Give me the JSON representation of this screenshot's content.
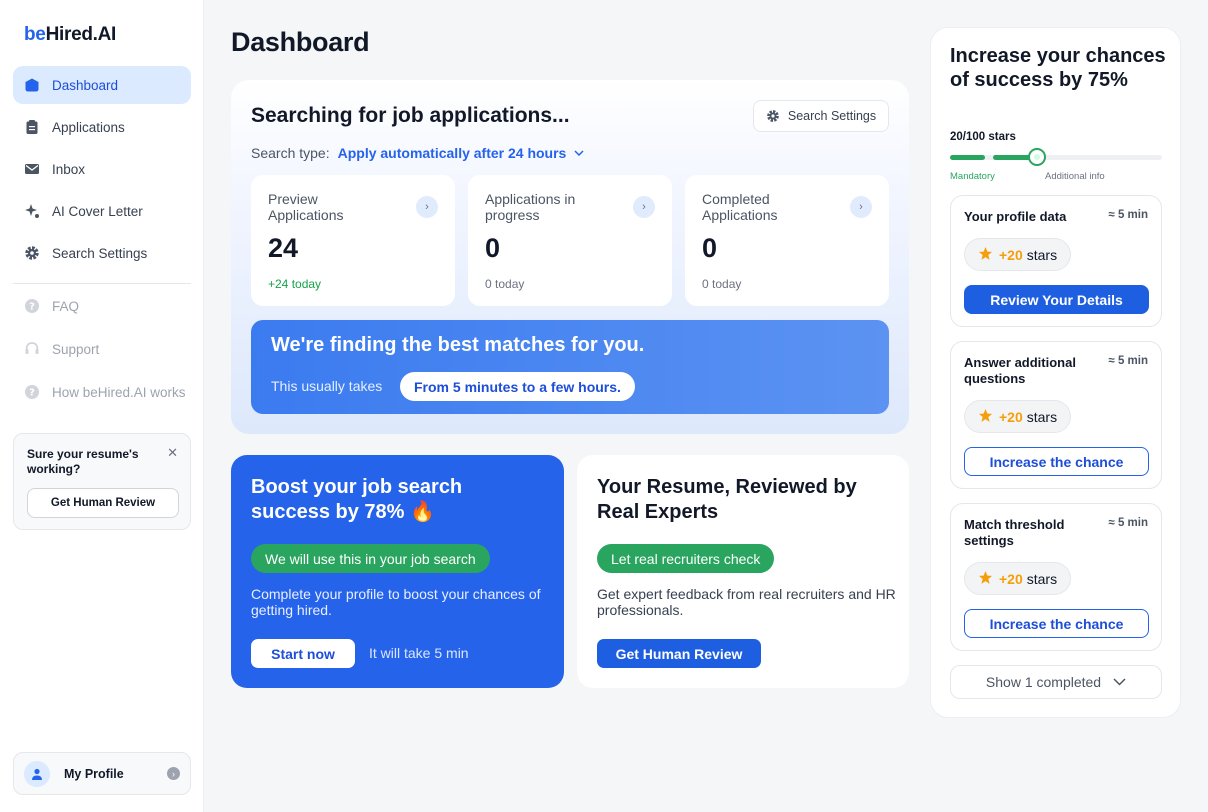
{
  "app": {
    "logo_prefix": "be",
    "logo_rest": "Hired.AI"
  },
  "sidebar": {
    "items": [
      {
        "label": "Dashboard",
        "icon": "dashboard-icon",
        "active": true
      },
      {
        "label": "Applications",
        "icon": "clipboard-icon"
      },
      {
        "label": "Inbox",
        "icon": "mail-icon"
      },
      {
        "label": "AI Cover Letter",
        "icon": "sparkle-icon"
      },
      {
        "label": "Search Settings",
        "icon": "gear-icon"
      }
    ],
    "secondary": [
      {
        "label": "FAQ",
        "icon": "help-icon"
      },
      {
        "label": "Support",
        "icon": "headset-icon"
      },
      {
        "label": "How beHired.AI works",
        "icon": "help-icon"
      }
    ],
    "promo": {
      "title": "Sure your resume's working?",
      "button": "Get Human Review"
    },
    "profile": {
      "label": "My Profile"
    }
  },
  "main": {
    "title": "Dashboard",
    "search": {
      "title": "Searching for job applications...",
      "settings_button": "Search Settings",
      "type_label": "Search type:",
      "type_value": "Apply automatically after 24 hours",
      "stats": [
        {
          "label": "Preview Applications",
          "value": "24",
          "sub": "+24 today"
        },
        {
          "label": "Applications in progress",
          "value": "0",
          "sub": "0 today"
        },
        {
          "label": "Completed Applications",
          "value": "0",
          "sub": "0 today"
        }
      ],
      "finding": {
        "title": "We're finding the best matches for you.",
        "label": "This usually takes",
        "pill": "From 5 minutes to a few hours."
      }
    },
    "boost": {
      "title": "Boost your job search success by 78% 🔥",
      "pill": "We will use this in your job search",
      "desc": "Complete your profile to boost your chances of getting hired.",
      "button": "Start now",
      "note": "It will take 5 min"
    },
    "review": {
      "title": "Your Resume, Reviewed by Real Experts",
      "pill": "Let real recruiters check",
      "desc": "Get expert feedback from real recruiters and HR professionals.",
      "button": "Get Human Review"
    }
  },
  "panel": {
    "title": "Increase your chances of success by 75%",
    "stars_label": "20/100 stars",
    "progress": 0.2,
    "mandatory_label": "Mandatory",
    "additional_label": "Additional info",
    "tasks": [
      {
        "title": "Your profile data",
        "time": "≈ 5 min",
        "plus": "+20",
        "stars_word": "stars",
        "button": "Review Your Details",
        "style": "primary"
      },
      {
        "title": "Answer additional questions",
        "time": "≈ 5 min",
        "plus": "+20",
        "stars_word": "stars",
        "button": "Increase the chance",
        "style": "outline"
      },
      {
        "title": "Match threshold settings",
        "time": "≈ 5 min",
        "plus": "+20",
        "stars_word": "stars",
        "button": "Increase the chance",
        "style": "outline"
      }
    ],
    "show_completed": "Show 1 completed"
  },
  "colors": {
    "accent": "#2563eb",
    "success": "#2aa55f",
    "star": "#f59e0b"
  }
}
